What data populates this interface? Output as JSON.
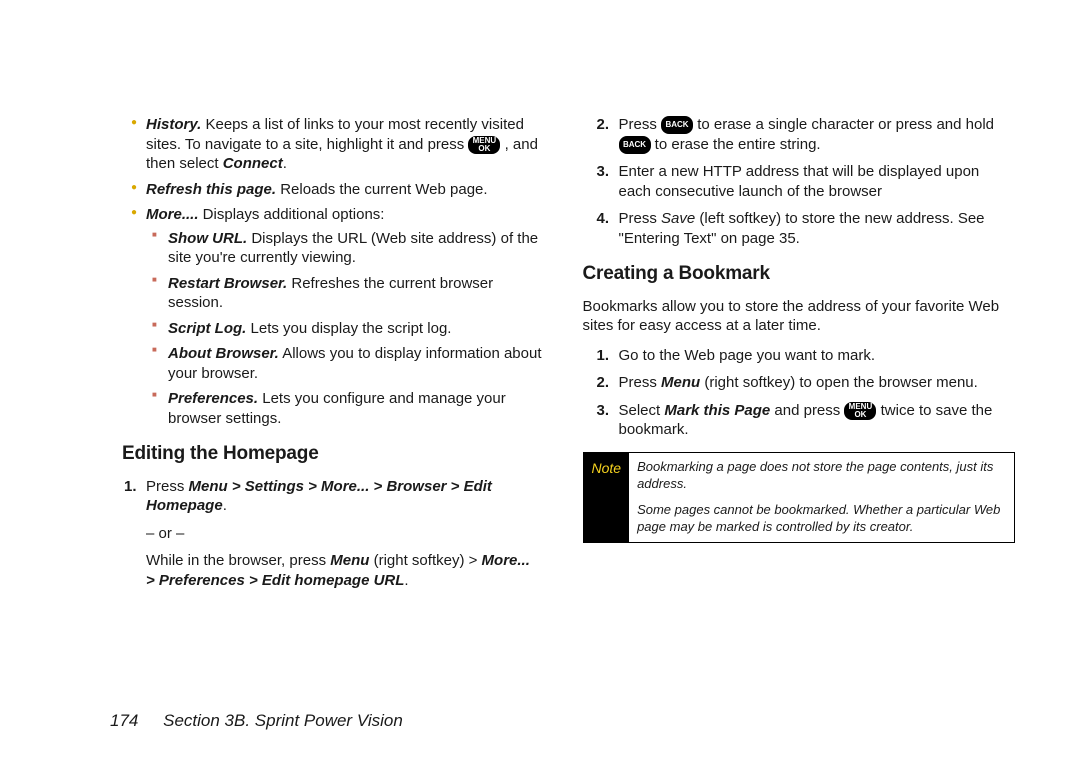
{
  "keys": {
    "menuok": "MENU\nOK",
    "back": "BACK"
  },
  "col1": {
    "bullets": [
      {
        "lead": "History.",
        "t1": "Keeps a list of links to your most recently visited sites. To navigate to a site, highlight it and press ",
        "t2": ", and then select ",
        "t3": "Connect",
        "t4": "."
      },
      {
        "lead": "Refresh this page.",
        "t1": " Reloads the current Web page."
      },
      {
        "lead": "More....",
        "t1": " Displays additional options:",
        "sub": [
          {
            "lead": "Show URL.",
            "t1": " Displays the URL (Web site address) of the site you're currently viewing."
          },
          {
            "lead": "Restart Browser.",
            "t1": " Refreshes the current browser session."
          },
          {
            "lead": "Script Log.",
            "t1": " Lets you display the script log."
          },
          {
            "lead": "About Browser.",
            "t1": " Allows you to display information about your browser."
          },
          {
            "lead": "Preferences.",
            "t1": " Lets you configure and manage your browser settings."
          }
        ]
      }
    ],
    "heading": "Editing the Homepage",
    "steps": [
      {
        "num": "1.",
        "t1": "Press ",
        "nav": "Menu > Settings > More... > Browser > Edit Homepage",
        "t2": ".",
        "or": "– or –",
        "t3": "While in the browser, press ",
        "b1": "Menu",
        "t4": " (right softkey) > ",
        "nav2": "More... > Preferences > Edit homepage URL",
        "t5": "."
      }
    ]
  },
  "col2": {
    "steps_top": [
      {
        "num": "2.",
        "t1": "Press ",
        "t2": " to erase a single character or press and hold ",
        "t3": " to erase the entire string."
      },
      {
        "num": "3.",
        "t1": "Enter a new HTTP address that will be displayed upon each consecutive launch of the browser"
      },
      {
        "num": "4.",
        "t1": "Press ",
        "i1": "Save",
        "t2": " (left softkey) to store the new address. See \"Entering Text\" on page 35."
      }
    ],
    "heading": "Creating a Bookmark",
    "intro": "Bookmarks allow you to store the address of your favorite Web sites for easy access at a later time.",
    "steps_bm": [
      {
        "num": "1.",
        "t1": "Go to the Web page you want to mark."
      },
      {
        "num": "2.",
        "t1": "Press ",
        "b1": "Menu",
        "t2": " (right softkey) to open the browser menu."
      },
      {
        "num": "3.",
        "t1": "Select ",
        "b1": "Mark this Page",
        "t2": " and press ",
        "t3": " twice to save the bookmark."
      }
    ],
    "note": {
      "label": "Note",
      "p1": "Bookmarking a page does not store the page contents, just its address.",
      "p2": "Some pages cannot be bookmarked. Whether a particular Web page may be marked is controlled by its creator."
    }
  },
  "footer": {
    "page": "174",
    "section": "Section 3B. Sprint Power Vision"
  }
}
